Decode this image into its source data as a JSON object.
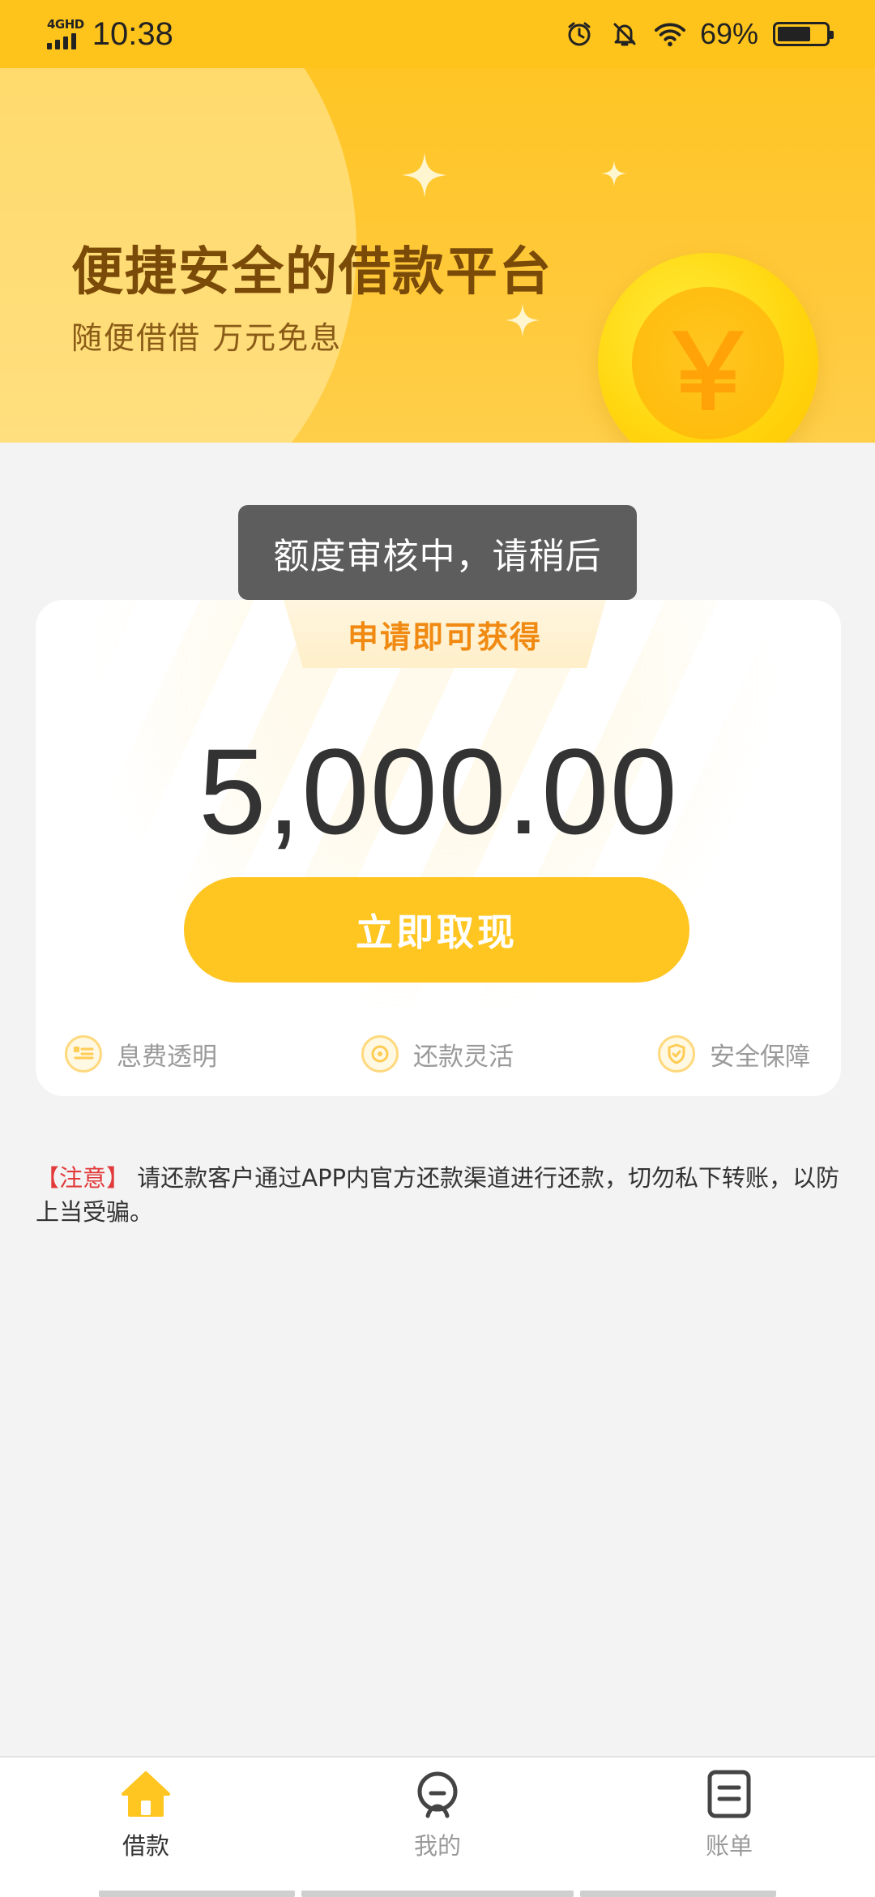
{
  "status_bar": {
    "network": "4GHD",
    "time": "10:38",
    "battery_percent": "69%",
    "battery_level": 0.69,
    "icons": [
      "signal-icon",
      "alarm-icon",
      "mute-bell-icon",
      "wifi-icon",
      "battery-icon"
    ]
  },
  "banner": {
    "title": "便捷安全的借款平台",
    "subtitle": "随便借借 万元免息",
    "coin_symbol": "￥"
  },
  "toast": {
    "message": "额度审核中，请稍后"
  },
  "card": {
    "ribbon_label": "申请即可获得",
    "amount": "5,000.00",
    "cta_label": "立即取现",
    "features": [
      {
        "label": "息费透明",
        "icon": "fee-list-icon"
      },
      {
        "label": "还款灵活",
        "icon": "flexible-repay-icon"
      },
      {
        "label": "安全保障",
        "icon": "shield-check-icon"
      }
    ]
  },
  "notice": {
    "tag": "【注意】",
    "text": " 请还款客户通过APP内官方还款渠道进行还款，切勿私下转账，以防上当受骗。"
  },
  "bottom_nav": {
    "items": [
      {
        "label": "借款",
        "icon": "home-icon",
        "active": true
      },
      {
        "label": "我的",
        "icon": "user-icon",
        "active": false
      },
      {
        "label": "账单",
        "icon": "bill-icon",
        "active": false
      }
    ]
  },
  "colors": {
    "brand_yellow": "#ffc521",
    "banner_text": "#7a4a08",
    "ribbon_text": "#f08a12",
    "notice_red": "#e23a3a",
    "page_bg": "#f3f3f3"
  }
}
